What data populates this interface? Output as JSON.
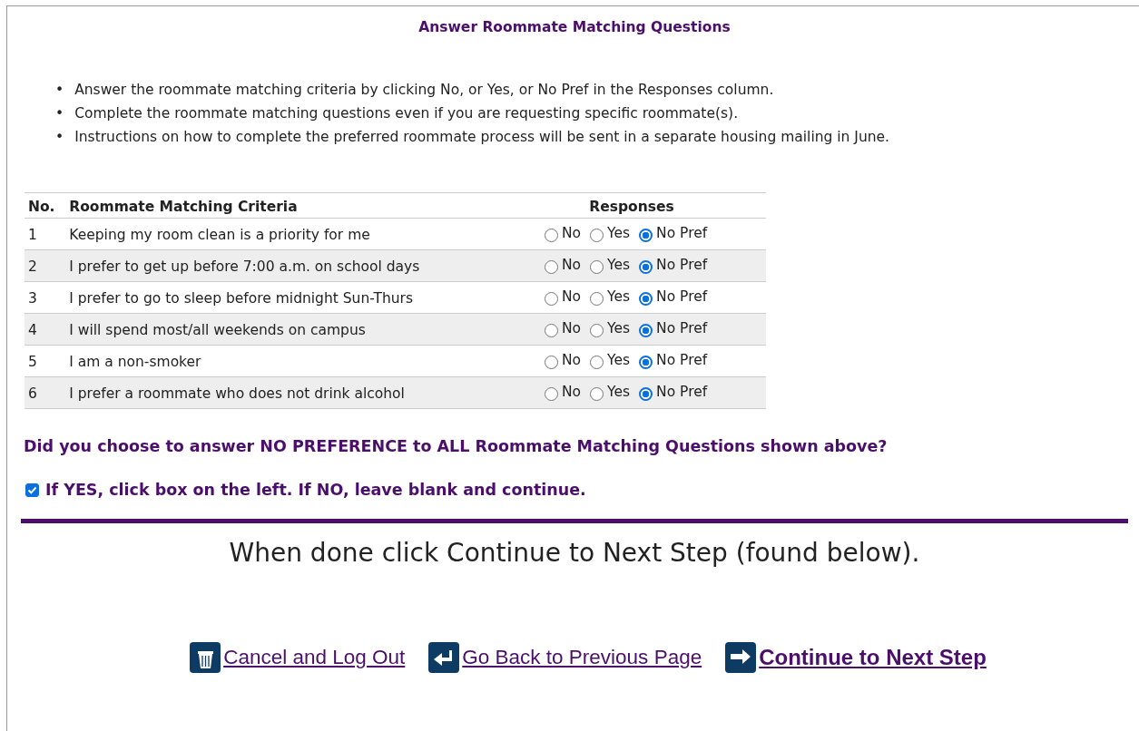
{
  "title": "Answer Roommate Matching Questions",
  "instructions": [
    {
      "bullet": "•",
      "text": "Answer the roommate matching criteria by clicking No, or Yes, or No Pref in the Responses column."
    },
    {
      "bullet": "•",
      "text": "Complete the roommate matching questions even if you are requesting specific roommate(s)."
    },
    {
      "bullet": "•",
      "text": "Instructions on how to complete the preferred roommate process will be sent in a separate housing mailing in June."
    }
  ],
  "table": {
    "columns": [
      "No.",
      "Roommate Matching Criteria",
      "Responses"
    ],
    "rows": [
      {
        "no": "1",
        "criteria": "Keeping my room clean is a priority for me",
        "options": [
          {
            "label": "No",
            "selected": false
          },
          {
            "label": "Yes",
            "selected": false
          },
          {
            "label": "No Pref",
            "selected": true
          }
        ]
      },
      {
        "no": "2",
        "criteria": "I prefer to get up before 7:00 a.m. on school days",
        "options": [
          {
            "label": "No",
            "selected": false
          },
          {
            "label": "Yes",
            "selected": false
          },
          {
            "label": "No Pref",
            "selected": true
          }
        ]
      },
      {
        "no": "3",
        "criteria": "I prefer to go to sleep before midnight Sun-Thurs",
        "options": [
          {
            "label": "No",
            "selected": false
          },
          {
            "label": "Yes",
            "selected": false
          },
          {
            "label": "No Pref",
            "selected": true
          }
        ]
      },
      {
        "no": "4",
        "criteria": "I will spend most/all weekends on campus",
        "options": [
          {
            "label": "No",
            "selected": false
          },
          {
            "label": "Yes",
            "selected": false
          },
          {
            "label": "No Pref",
            "selected": true
          }
        ]
      },
      {
        "no": "5",
        "criteria": "I am a non-smoker",
        "options": [
          {
            "label": "No",
            "selected": false
          },
          {
            "label": "Yes",
            "selected": false
          },
          {
            "label": "No Pref",
            "selected": true
          }
        ]
      },
      {
        "no": "6",
        "criteria": "I prefer a roommate who does not drink alcohol",
        "options": [
          {
            "label": "No",
            "selected": false
          },
          {
            "label": "Yes",
            "selected": false
          },
          {
            "label": "No Pref",
            "selected": true
          }
        ]
      }
    ]
  },
  "question": "Did you choose to answer NO PREFERENCE to ALL Roommate Matching Questions shown above?",
  "confirm": {
    "label": "If YES, click box on the left. If NO, leave blank and continue.",
    "checked": true
  },
  "done_note": "When done click Continue to Next Step (found below).",
  "links": [
    {
      "kind": "trash",
      "label": "Cancel and Log Out",
      "bold": false
    },
    {
      "kind": "back",
      "label": "Go Back to Previous Page",
      "bold": false
    },
    {
      "kind": "forward",
      "label": "Continue to Next Step",
      "bold": true
    }
  ]
}
